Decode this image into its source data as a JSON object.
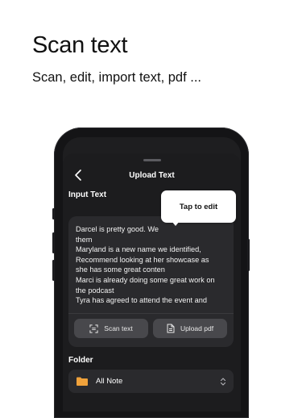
{
  "hero": {
    "title": "Scan text",
    "subtitle": "Scan, edit, import text, pdf ..."
  },
  "screen": {
    "nav": {
      "title": "Upload Text",
      "back_icon": "chevron-left-icon"
    },
    "input_section": {
      "label": "Input Text",
      "text": "Darcel is pretty good. We\nthem\nMaryland is a new name we identified,\nRecommend looking at her showcase as\nshe has some great conten\nMarci is already doing some great work on\nthe podcast\nTyra has agreed to attend the event and\nprovide coverage"
    },
    "actions": [
      {
        "label": "Scan text",
        "icon": "scan-icon"
      },
      {
        "label": "Upload pdf",
        "icon": "document-icon"
      }
    ],
    "folder_section": {
      "label": "Folder",
      "selected": "All Note",
      "icon_color": "#F0A23B"
    }
  },
  "tooltip": {
    "text": "Tap to edit"
  }
}
